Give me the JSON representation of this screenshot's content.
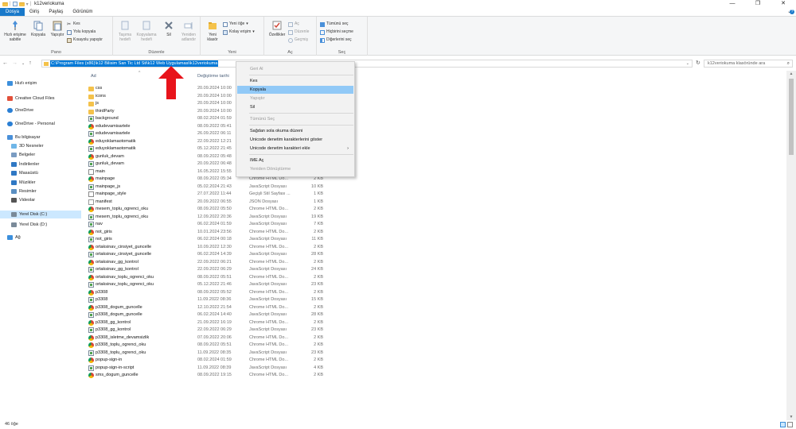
{
  "window": {
    "title": "k12veriokuma",
    "controls": [
      "—",
      "❐",
      "✕"
    ]
  },
  "tabs": {
    "file": "Dosya",
    "home": "Giriş",
    "share": "Paylaş",
    "view": "Görünüm",
    "expand": "⌄"
  },
  "ribbon": {
    "clipboard": {
      "label": "Pano",
      "pin": "Hızlı erişime sabitle",
      "copy": "Kopyala",
      "paste": "Yapıştır",
      "cut": "Kes",
      "copy_path": "Yolu kopyala",
      "paste_shortcut": "Kısayolu yapıştır"
    },
    "organize": {
      "label": "Düzenle",
      "move_to": "Taşıma hedefi",
      "copy_to": "Kopyalama hedefi",
      "delete": "Sil",
      "rename": "Yeniden adlandır"
    },
    "new": {
      "label": "Yeni",
      "new_folder": "Yeni klasör",
      "new_item": "Yeni öğe",
      "easy_access": "Kolay erişim"
    },
    "open": {
      "label": "Aç",
      "properties": "Özellikler",
      "open": "Aç",
      "edit": "Düzenle",
      "history": "Geçmiş"
    },
    "select": {
      "label": "Seç",
      "select_all": "Tümünü seç",
      "select_none": "Hiçbirini seçme",
      "invert": "Diğerlerini seç"
    }
  },
  "address": {
    "path": "C:\\Program Files (x86)\\k12 Bilisim San Tic Ltd Sti\\k12 Web Uygulamasi\\k12veriokuma",
    "search_placeholder": "k12veriokuma klasöründe ara"
  },
  "nav": [
    {
      "label": "Hızlı erişim",
      "icon": "star-icon"
    },
    {
      "label": "Creative Cloud Files",
      "icon": "creative-cloud-icon"
    },
    {
      "label": "OneDrive",
      "icon": "cloud-icon"
    },
    {
      "label": "OneDrive - Personal",
      "icon": "cloud-icon"
    },
    {
      "label": "Bu bilgisayar",
      "icon": "computer-icon"
    },
    {
      "label": "3D Nesneler",
      "icon": "cube-icon"
    },
    {
      "label": "Belgeler",
      "icon": "documents-icon"
    },
    {
      "label": "İndirilenler",
      "icon": "download-icon"
    },
    {
      "label": "Masaüstü",
      "icon": "desktop-icon"
    },
    {
      "label": "Müzikler",
      "icon": "music-icon"
    },
    {
      "label": "Resimler",
      "icon": "pictures-icon"
    },
    {
      "label": "Videolar",
      "icon": "video-icon"
    },
    {
      "label": "Yerel Disk (C:)",
      "icon": "drive-icon"
    },
    {
      "label": "Yerel Disk (D:)",
      "icon": "drive-icon"
    },
    {
      "label": "Ağ",
      "icon": "network-icon"
    }
  ],
  "columns": {
    "name": "Ad",
    "date": "Değiştirme tarihi"
  },
  "files": [
    {
      "name": "css",
      "date": "20.09.2024 10:00",
      "type": "",
      "size": "",
      "icon": "folder"
    },
    {
      "name": "icons",
      "date": "20.09.2024 10:00",
      "type": "",
      "size": "",
      "icon": "folder"
    },
    {
      "name": "js",
      "date": "20.09.2024 10:00",
      "type": "",
      "size": "",
      "icon": "folder"
    },
    {
      "name": "thirdParty",
      "date": "20.09.2024 10:00",
      "type": "",
      "size": "",
      "icon": "folder"
    },
    {
      "name": "background",
      "date": "08.02.2024 01:59",
      "type": "",
      "size": "",
      "icon": "js"
    },
    {
      "name": "edudevamisartele",
      "date": "08.09.2022 05:41",
      "type": "",
      "size": "",
      "icon": "chrome"
    },
    {
      "name": "edudevamisartele",
      "date": "26.09.2022 06:11",
      "type": "",
      "size": "",
      "icon": "js"
    },
    {
      "name": "eduyoklamaotomatik",
      "date": "22.09.2022 12:21",
      "type": "",
      "size": "",
      "icon": "chrome"
    },
    {
      "name": "eduyoklamaotomatik",
      "date": "05.12.2022 21:45",
      "type": "",
      "size": "",
      "icon": "js"
    },
    {
      "name": "gunluk_devam",
      "date": "08.09.2022 05:48",
      "type": "",
      "size": "",
      "icon": "chrome"
    },
    {
      "name": "gunluk_devam",
      "date": "20.09.2022 06:48",
      "type": "",
      "size": "",
      "icon": "js"
    },
    {
      "name": "main",
      "date": "16.05.2022 15:55",
      "type": "Geçişli Stil Sayfası ...",
      "size": "1 KB",
      "icon": "css"
    },
    {
      "name": "mainpage",
      "date": "08.09.2022 05:34",
      "type": "Chrome HTML Do...",
      "size": "2 KB",
      "icon": "chrome"
    },
    {
      "name": "mainpage_js",
      "date": "05.02.2024 21:43",
      "type": "JavaScript Dosyası",
      "size": "10 KB",
      "icon": "js"
    },
    {
      "name": "mainpage_style",
      "date": "27.07.2022 11:44",
      "type": "Geçişli Stil Sayfası ...",
      "size": "1 KB",
      "icon": "css"
    },
    {
      "name": "manifest",
      "date": "20.09.2022 06:55",
      "type": "JSON Dosyası",
      "size": "1 KB",
      "icon": "file"
    },
    {
      "name": "mesem_toplu_ogrenci_oku",
      "date": "08.09.2022 05:50",
      "type": "Chrome HTML Do...",
      "size": "2 KB",
      "icon": "chrome"
    },
    {
      "name": "mesem_toplu_ogrenci_oku",
      "date": "12.09.2022 20:36",
      "type": "JavaScript Dosyası",
      "size": "19 KB",
      "icon": "js"
    },
    {
      "name": "nav",
      "date": "06.02.2024 01:59",
      "type": "JavaScript Dosyası",
      "size": "7 KB",
      "icon": "js"
    },
    {
      "name": "not_giris",
      "date": "10.01.2024 23:56",
      "type": "Chrome HTML Do...",
      "size": "2 KB",
      "icon": "chrome"
    },
    {
      "name": "not_giris",
      "date": "06.02.2024 00:18",
      "type": "JavaScript Dosyası",
      "size": "11 KB",
      "icon": "js"
    },
    {
      "name": "ortaksinav_cinsiyet_guncelle",
      "date": "10.09.2022 12:30",
      "type": "Chrome HTML Do...",
      "size": "2 KB",
      "icon": "chrome"
    },
    {
      "name": "ortaksinav_cinsiyet_guncelle",
      "date": "06.02.2024 14:39",
      "type": "JavaScript Dosyası",
      "size": "28 KB",
      "icon": "js"
    },
    {
      "name": "ortaksinav_gg_kontrol",
      "date": "22.09.2022 06:21",
      "type": "Chrome HTML Do...",
      "size": "2 KB",
      "icon": "chrome"
    },
    {
      "name": "ortaksinav_gg_kontrol",
      "date": "22.09.2022 06:29",
      "type": "JavaScript Dosyası",
      "size": "24 KB",
      "icon": "js"
    },
    {
      "name": "ortaksinav_toplu_ogrenci_oku",
      "date": "08.09.2022 05:51",
      "type": "Chrome HTML Do...",
      "size": "2 KB",
      "icon": "chrome"
    },
    {
      "name": "ortaksinav_toplu_ogrenci_oku",
      "date": "05.12.2022 21:46",
      "type": "JavaScript Dosyası",
      "size": "23 KB",
      "icon": "js"
    },
    {
      "name": "p3308",
      "date": "08.09.2022 05:52",
      "type": "Chrome HTML Do...",
      "size": "2 KB",
      "icon": "chrome"
    },
    {
      "name": "p3308",
      "date": "11.09.2022 08:36",
      "type": "JavaScript Dosyası",
      "size": "15 KB",
      "icon": "js"
    },
    {
      "name": "p3308_dogum_guncelle",
      "date": "12.10.2022 21:54",
      "type": "Chrome HTML Do...",
      "size": "2 KB",
      "icon": "chrome"
    },
    {
      "name": "p3308_dogum_guncelle",
      "date": "06.02.2024 14:40",
      "type": "JavaScript Dosyası",
      "size": "28 KB",
      "icon": "js"
    },
    {
      "name": "p3308_gg_kontrol",
      "date": "21.09.2022 16:19",
      "type": "Chrome HTML Do...",
      "size": "2 KB",
      "icon": "chrome"
    },
    {
      "name": "p3308_gg_kontrol",
      "date": "22.09.2022 06:29",
      "type": "JavaScript Dosyası",
      "size": "23 KB",
      "icon": "js"
    },
    {
      "name": "p3308_isletme_devamsizlik",
      "date": "07.09.2022 20:06",
      "type": "Chrome HTML Do...",
      "size": "2 KB",
      "icon": "chrome"
    },
    {
      "name": "p3308_toplu_ogrenci_oku",
      "date": "08.09.2022 05:51",
      "type": "Chrome HTML Do...",
      "size": "2 KB",
      "icon": "chrome"
    },
    {
      "name": "p3308_toplu_ogrenci_oku",
      "date": "11.09.2022 08:35",
      "type": "JavaScript Dosyası",
      "size": "23 KB",
      "icon": "js"
    },
    {
      "name": "popup-sign-in",
      "date": "08.02.2024 01:59",
      "type": "Chrome HTML Do...",
      "size": "2 KB",
      "icon": "chrome"
    },
    {
      "name": "popup-sign-in-script",
      "date": "11.09.2022 08:39",
      "type": "JavaScript Dosyası",
      "size": "4 KB",
      "icon": "js"
    },
    {
      "name": "sms_dogum_guncelle",
      "date": "08.09.2022 19:15",
      "type": "Chrome HTML Do...",
      "size": "2 KB",
      "icon": "chrome"
    }
  ],
  "context_menu": {
    "undo": "Geri Al",
    "cut": "Kes",
    "copy": "Kopyala",
    "paste": "Yapıştır",
    "delete": "Sil",
    "select_all": "Tümünü Seç",
    "rtl": "Sağdan sola okuma düzeni",
    "show_unicode": "Unicode denetim karakterlerini göster",
    "insert_unicode": "Unicode denetim karakteri ekle",
    "ime_open": "IME Aç",
    "reconversion": "Yeniden Dönüştürme"
  },
  "status": {
    "item_count": "46 öğe"
  },
  "colors": {
    "accent": "#0078d7",
    "file_tab": "#1979ca",
    "highlight": "#91c9f7",
    "annotation": "#e8141b"
  }
}
